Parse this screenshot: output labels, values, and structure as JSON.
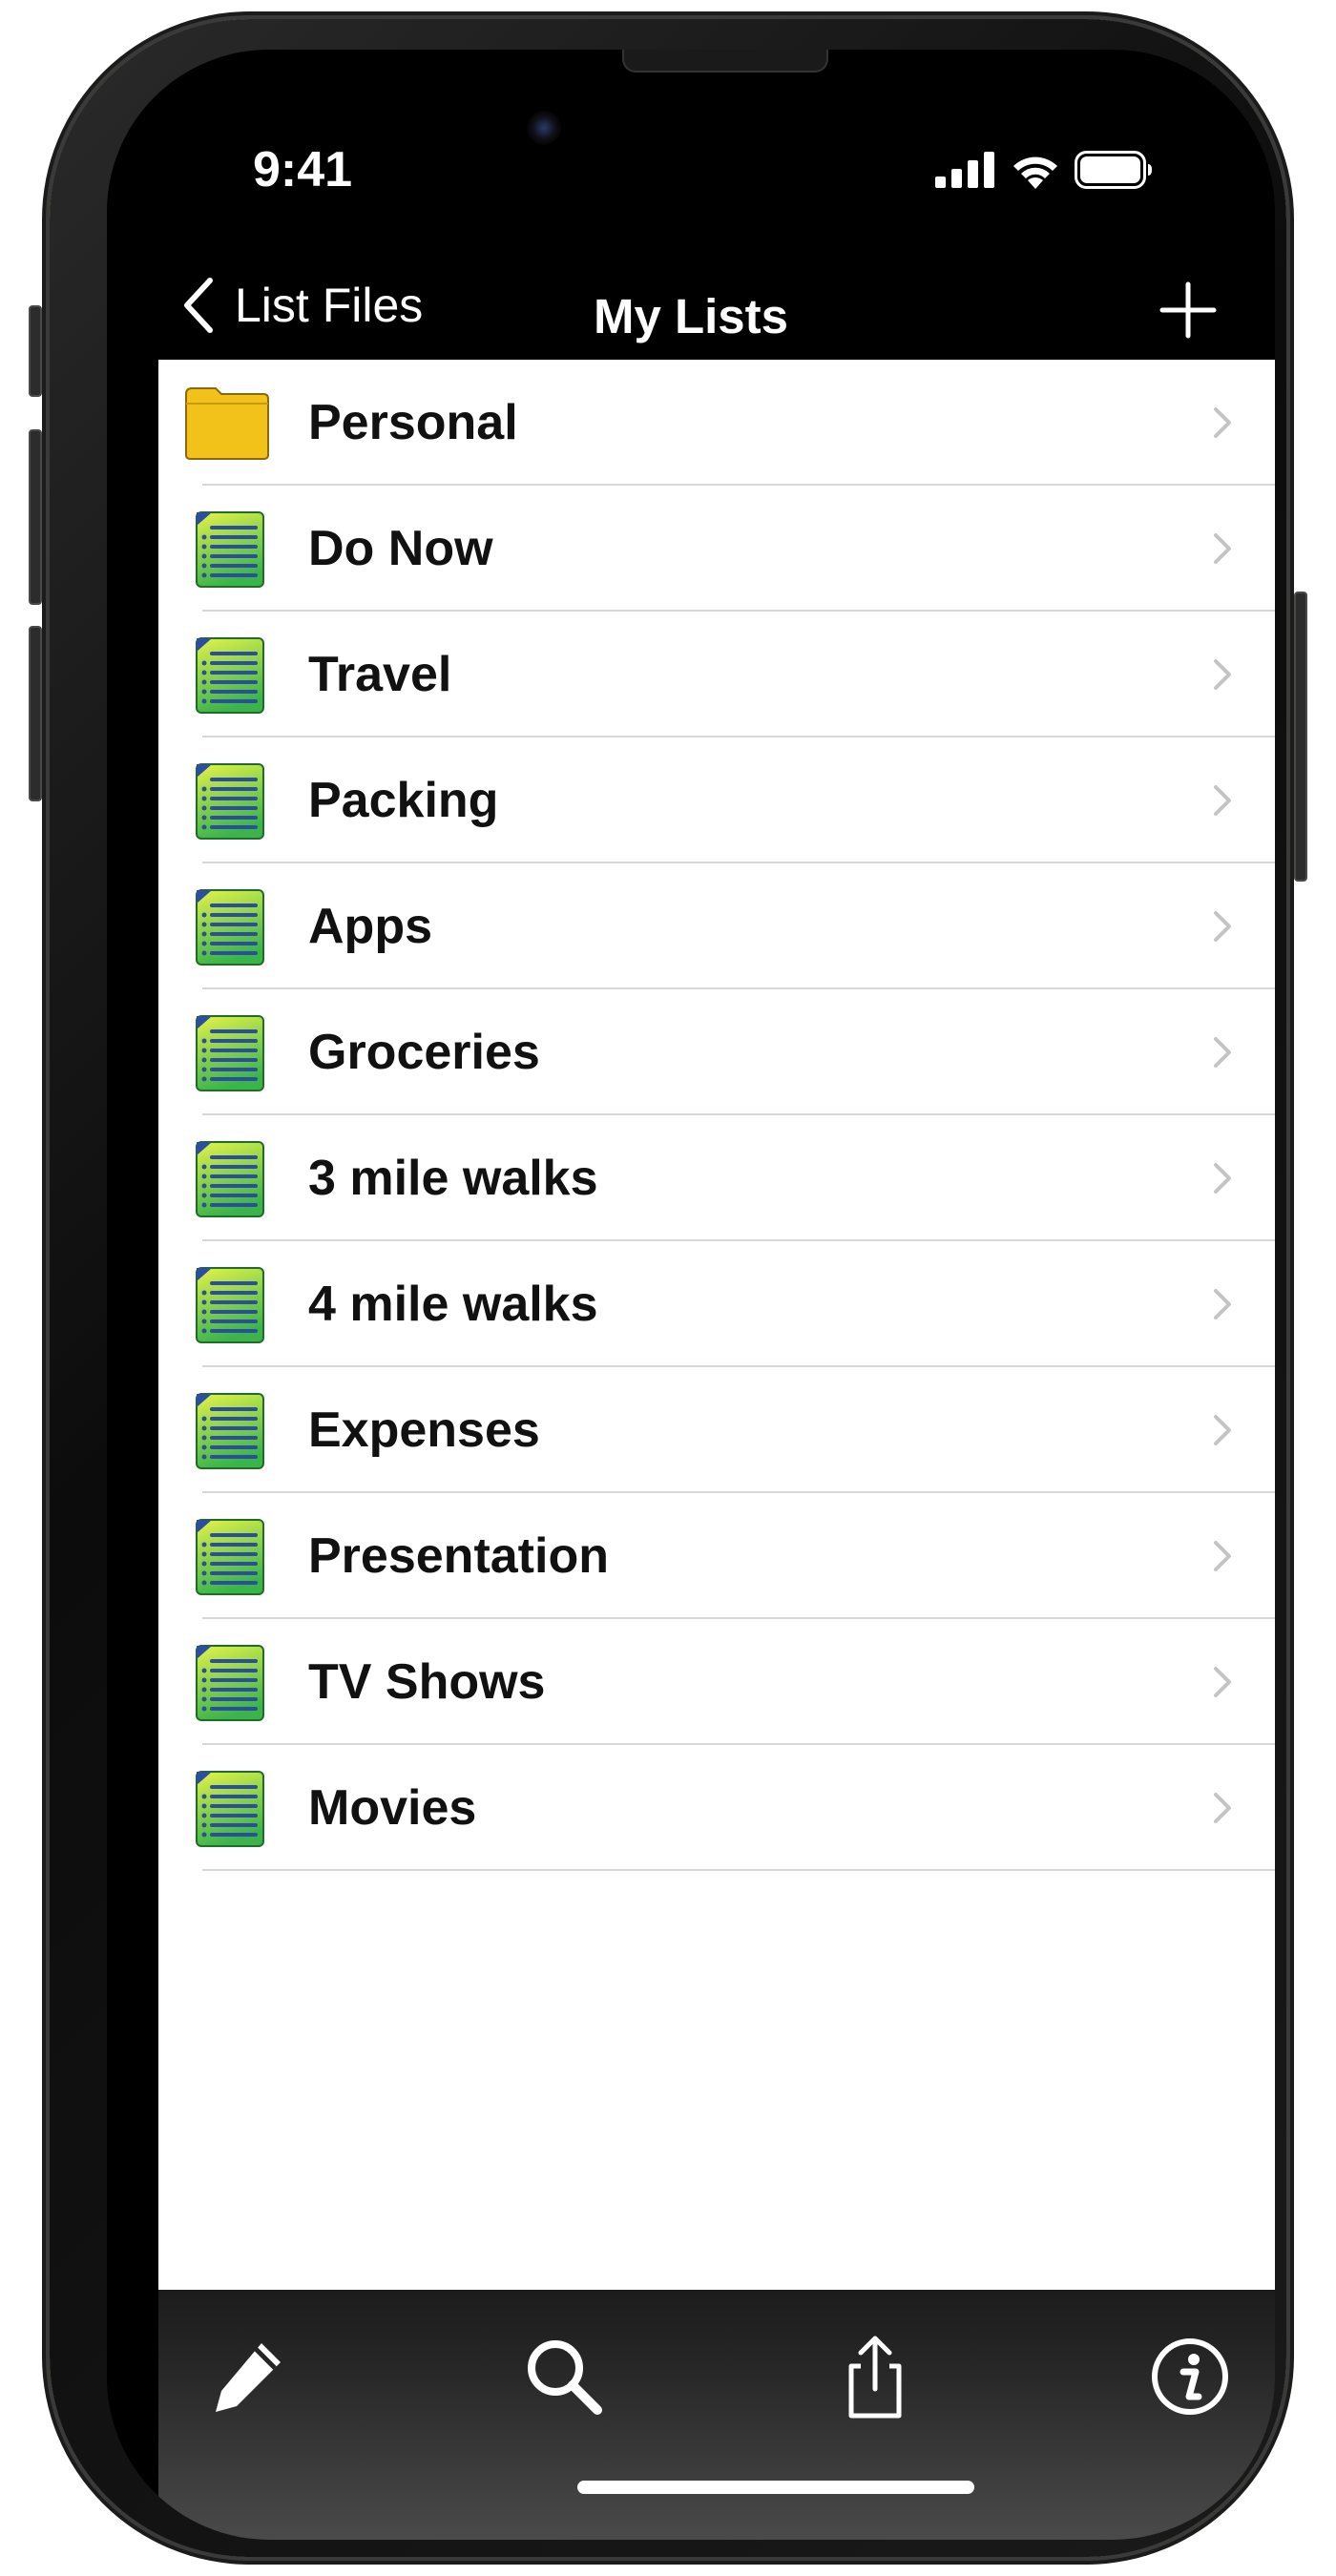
{
  "status_bar": {
    "time": "9:41",
    "icons": [
      "signal-icon",
      "wifi-icon",
      "battery-icon"
    ]
  },
  "nav": {
    "back_label": "List Files",
    "title": "My Lists",
    "add_icon": "plus-icon"
  },
  "lists": [
    {
      "label": "Personal",
      "icon": "folder-icon"
    },
    {
      "label": "Do Now",
      "icon": "list-document-icon"
    },
    {
      "label": "Travel",
      "icon": "list-document-icon"
    },
    {
      "label": "Packing",
      "icon": "list-document-icon"
    },
    {
      "label": "Apps",
      "icon": "list-document-icon"
    },
    {
      "label": "Groceries",
      "icon": "list-document-icon"
    },
    {
      "label": "3 mile walks",
      "icon": "list-document-icon"
    },
    {
      "label": "4 mile walks",
      "icon": "list-document-icon"
    },
    {
      "label": "Expenses",
      "icon": "list-document-icon"
    },
    {
      "label": "Presentation",
      "icon": "list-document-icon"
    },
    {
      "label": "TV Shows",
      "icon": "list-document-icon"
    },
    {
      "label": "Movies",
      "icon": "list-document-icon"
    }
  ],
  "toolbar": {
    "buttons": [
      "pencil-icon",
      "search-icon",
      "share-icon",
      "info-icon"
    ]
  },
  "colors": {
    "folder": "#f2c21b",
    "doc_green": "#3bb54a",
    "doc_yellow": "#e4f24a",
    "doc_lines": "#2b4f9e",
    "chevron": "#c4c4c6",
    "separator": "#d8d8dc"
  }
}
